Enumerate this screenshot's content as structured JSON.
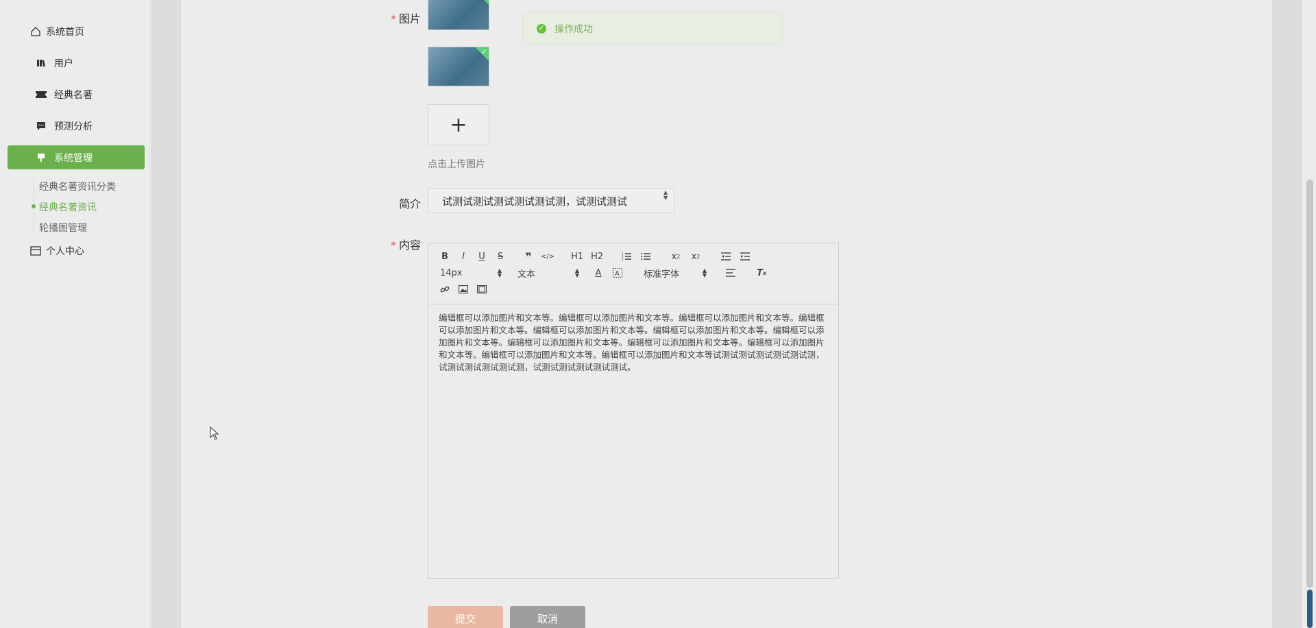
{
  "sidebar": {
    "items": [
      {
        "label": "系统首页",
        "icon": "home-icon"
      },
      {
        "label": "用户",
        "icon": "book-icon"
      },
      {
        "label": "经典名著",
        "icon": "ticket-icon"
      },
      {
        "label": "预测分析",
        "icon": "chat-icon"
      },
      {
        "label": "系统管理",
        "icon": "pin-icon"
      }
    ],
    "sub_items": [
      {
        "label": "经典名著资讯分类"
      },
      {
        "label": "经典名著资讯"
      },
      {
        "label": "轮播图管理"
      }
    ],
    "personal": {
      "label": "个人中心",
      "icon": "card-icon"
    }
  },
  "form": {
    "image_label": "图片",
    "required_mark": "*",
    "upload_text": "点击上传图片",
    "upload_plus": "+",
    "intro_label": "简介",
    "intro_value": "试测试测试测试测试测试测，试测试测试",
    "content_label": "内容",
    "content_value": "编辑框可以添加图片和文本等。编辑框可以添加图片和文本等。编辑框可以添加图片和文本等。编辑框可以添加图片和文本等。编辑框可以添加图片和文本等。编辑框可以添加图片和文本等。编辑框可以添加图片和文本等。编辑框可以添加图片和文本等。编辑框可以添加图片和文本等。编辑框可以添加图片和文本等。编辑框可以添加图片和文本等。编辑框可以添加图片和文本等试测试测试测试测试测试测，试测试测试测试测试测，试测试测试测试测试测试。"
  },
  "editor": {
    "font_size": "14px",
    "text_type": "文本",
    "font_family": "标准字体",
    "h1": "H1",
    "h2": "H2",
    "bold": "B",
    "italic": "I",
    "underline": "U",
    "strike": "S"
  },
  "buttons": {
    "submit": "提交",
    "cancel": "取消"
  },
  "toast": {
    "message": "操作成功"
  },
  "colors": {
    "accent": "#6ab04c",
    "required": "#e74c3c",
    "submit": "#e9b7a2",
    "cancel": "#9e9e9e"
  }
}
